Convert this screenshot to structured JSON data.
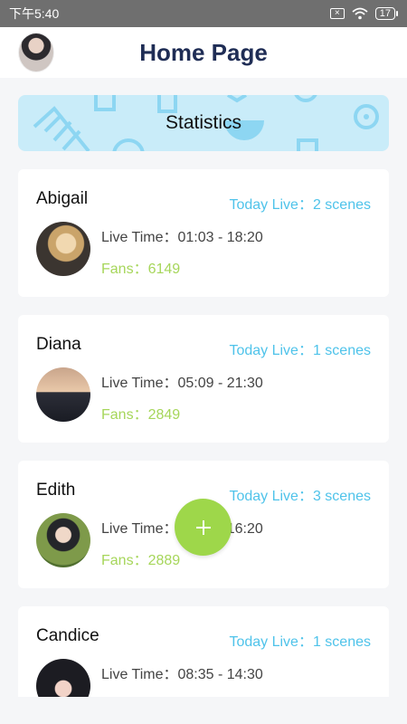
{
  "status_bar": {
    "time": "下午5:40",
    "battery": "17"
  },
  "header": {
    "title": "Home Page"
  },
  "banner": {
    "label": "Statistics"
  },
  "cards": [
    {
      "name": "Abigail",
      "live": "Today Live：2 scenes",
      "time": "Live Time：01:03 - 18:20",
      "fans": "Fans：6149"
    },
    {
      "name": "Diana",
      "live": "Today Live：1 scenes",
      "time": "Live Time：05:09 - 21:30",
      "fans": "Fans：2849"
    },
    {
      "name": "Edith",
      "live": "Today Live：3 scenes",
      "time": "Live Time：06:06 - 16:20",
      "fans": "Fans：2889"
    },
    {
      "name": "Candice",
      "live": "Today Live：1 scenes",
      "time": "Live Time：08:35 - 14:30",
      "fans": ""
    }
  ],
  "colors": {
    "live": "#4fc3ea",
    "fans": "#a6d65a",
    "fab": "#9ed74a",
    "title": "#1f2d55",
    "banner": "#c9ecf9"
  },
  "icons": {
    "fab": "plus-icon",
    "wifi": "wifi-icon",
    "sim": "sim-off-icon",
    "battery": "battery-icon"
  }
}
